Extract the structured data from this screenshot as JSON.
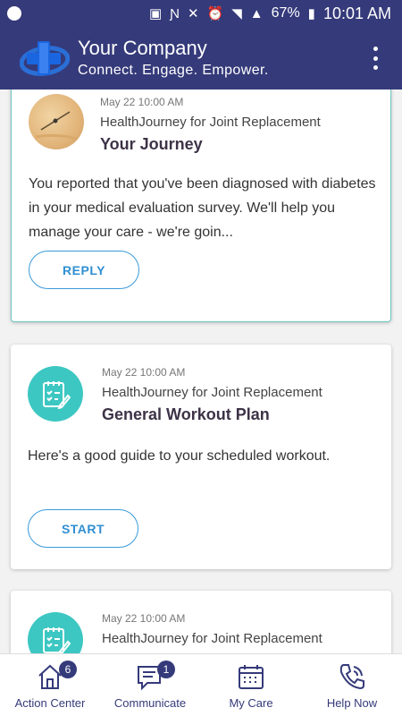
{
  "status_bar": {
    "battery": "67%",
    "time": "10:01 AM"
  },
  "header": {
    "title": "Your Company",
    "subtitle": "Connect. Engage. Empower.",
    "menu_icon": "more-vert-icon"
  },
  "cards": [
    {
      "date": "May 22 10:00 AM",
      "source": "HealthJourney for Joint Replacement",
      "title": "Your Journey",
      "body": "You reported that you've been diagnosed with diabetes in your medical evaluation survey. We'll help you manage your care - we're goin...",
      "button": "REPLY",
      "thumbnail": "journey-photo"
    },
    {
      "date": "May 22 10:00 AM",
      "source": "HealthJourney for Joint Replacement",
      "title": "General Workout Plan",
      "body": "Here's a good guide to your scheduled workout.",
      "button": "START",
      "thumbnail": "checklist-icon"
    },
    {
      "date": "May 22 10:00 AM",
      "source": "HealthJourney for Joint Replacement",
      "thumbnail": "checklist-icon"
    }
  ],
  "bottom_nav": [
    {
      "label": "Action Center",
      "icon": "home-icon",
      "badge": "6"
    },
    {
      "label": "Communicate",
      "icon": "chat-icon",
      "badge": "1"
    },
    {
      "label": "My Care",
      "icon": "calendar-icon"
    },
    {
      "label": "Help Now",
      "icon": "phone-icon"
    }
  ],
  "colors": {
    "primary": "#353a7a",
    "accent": "#3dc7c2",
    "button": "#2f8fd3"
  }
}
